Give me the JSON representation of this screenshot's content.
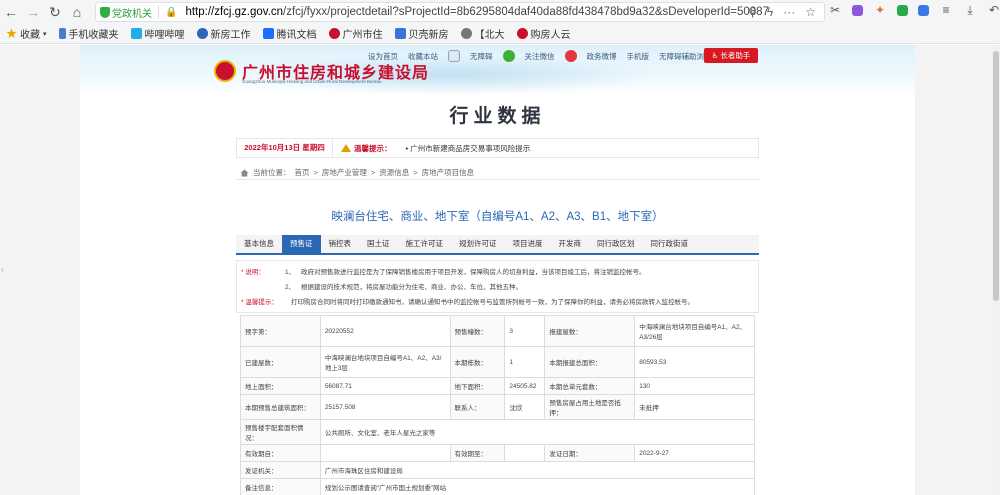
{
  "browser": {
    "gov_badge": "党政机关",
    "url_host": "http://zfcj.gz.gov.cn",
    "url_path": "/zfcj/fyxx/projectdetail?sProjectId=8b6295804daf40da88fd438478bd9a32&sDeveloperId=50887",
    "bookmarks": [
      {
        "label": "收藏",
        "icon": "star-icon",
        "color": "#f0a400"
      },
      {
        "label": "手机收藏夹",
        "icon": "phone-icon",
        "color": "#4a7bd0"
      },
      {
        "label": "哔哩哔哩",
        "icon": "bilibili-icon",
        "color": "#23ade5"
      },
      {
        "label": "新房工作",
        "icon": "globe-icon",
        "color": "#2a67b4"
      },
      {
        "label": "腾讯文档",
        "icon": "docs-icon",
        "color": "#1e6fff"
      },
      {
        "label": "广州市住",
        "icon": "gov-icon",
        "color": "#c8102e"
      },
      {
        "label": "贝壳新房",
        "icon": "shell-icon",
        "color": "#3a72d8"
      },
      {
        "label": "【北大",
        "icon": "globe-icon",
        "color": "#777777"
      },
      {
        "label": "购房人云",
        "icon": "gov-icon",
        "color": "#c8102e"
      }
    ]
  },
  "site": {
    "logo_cn": "广州市住房和城乡建设局",
    "logo_en": "Guangzhou Municipal Housing and Urban-Rural Development Bureau",
    "topnav": [
      "设为首页",
      "收藏本站",
      "无障碍",
      "关注微信",
      "政务微博",
      "手机版",
      "无障碍辅助浏览"
    ],
    "elder_button": "长者助手",
    "page_title": "行业数据",
    "tip_date": "2022年10月13日 星期四",
    "tip_label": "温馨提示：",
    "tip_text": "• 广州市新建商品房交易事项风险提示",
    "breadcrumb": [
      "当前位置：",
      "首页",
      ">",
      "房地产业管理",
      ">",
      "资源信息",
      ">",
      "房地产项目信息"
    ]
  },
  "project": {
    "title": "映澜台住宅、商业、地下室（自编号A1、A2、A3、B1、地下室）",
    "tabs": [
      "基本信息",
      "预售证",
      "销控表",
      "国土证",
      "施工许可证",
      "规划许可证",
      "项目进度",
      "开发商",
      "同行政区划",
      "同行政街道"
    ],
    "active_tab": 1,
    "notes": [
      {
        "label": "* 说明：",
        "num": "1、",
        "text": "政府对预售款进行监控是为了保障销售楼房用于项目开发，保障购房人的切身利益，当该项目竣工后，将注销监控帐号。"
      },
      {
        "label": "",
        "num": "2、",
        "text": "根据建设的技术规范，将房屋功能分为住宅、商业、办公、车位、其他五种。"
      },
      {
        "label": "* 温馨提示：",
        "num": "",
        "text": "打印购房合同时将同时打印缴款通知书，请确认通知书中的监控帐号与监管所列帐号一致，为了保障你的利益，请务必将房款转入监控帐号。"
      }
    ],
    "table": {
      "r1": [
        "预字第：",
        "20220552",
        "预售幢数：",
        "3",
        "报建屋数：",
        "中海映澜台地块项目自编号A1、A2、A3/26层"
      ],
      "r2": [
        "已建屋数：",
        "中海映澜台地块项目自编号A1、A2、A3/地上3层",
        "本期栋数：",
        "1",
        "本期报建总面积：",
        "80593.53"
      ],
      "r3": [
        "地上面积：",
        "56087.71",
        "地下面积：",
        "24505.82",
        "本期总单元套数：",
        "130"
      ],
      "r4": [
        "本期预售总建筑面积：",
        "25157.508",
        "联系人：",
        "沈欣",
        "预售房屋占用土地是否抵押：",
        "未抵押"
      ],
      "r5": [
        "预售楼宇配套面积情况：",
        "公共厕所、文化室、老年人星光之家等"
      ],
      "r6": [
        "有效期自：",
        "",
        "有效期至：",
        "",
        "发证日期：",
        "2022-9-27"
      ],
      "r7": [
        "发证机关：",
        "广州市海珠区住房和建设局"
      ],
      "r8": [
        "备注信息：",
        "规划公示图请查阅“广州市国土规划委”网站"
      ]
    }
  }
}
